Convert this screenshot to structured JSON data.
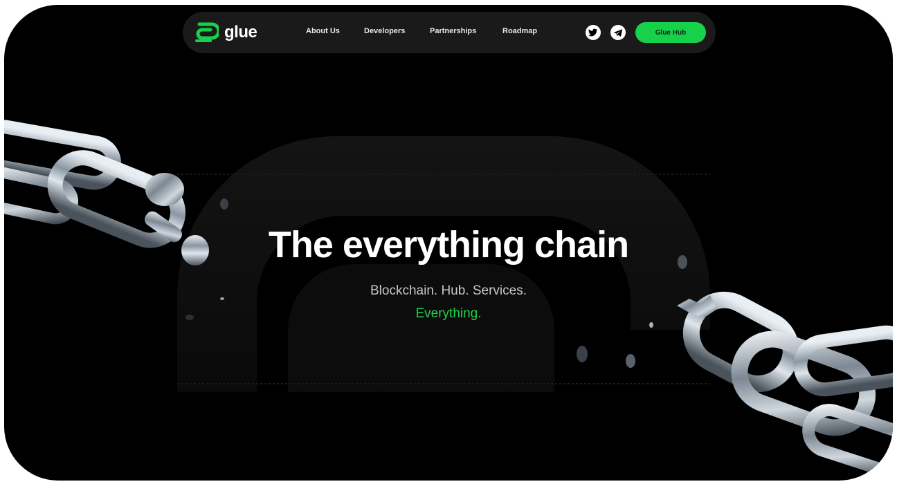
{
  "brand": {
    "name": "glue",
    "accent": "#18d14b",
    "logo_icon": "glue-logo-icon"
  },
  "nav": {
    "links": [
      {
        "label": "About Us"
      },
      {
        "label": "Developers"
      },
      {
        "label": "Partnerships"
      },
      {
        "label": "Roadmap"
      }
    ],
    "social": [
      {
        "icon": "twitter-icon"
      },
      {
        "icon": "telegram-icon"
      }
    ],
    "cta_label": "Glue Hub"
  },
  "hero": {
    "title": "The everything chain",
    "subtitle": "Blockchain. Hub. Services.",
    "accent_text": "Everything."
  },
  "colors": {
    "background": "#000000",
    "nav_background": "#1a1a1a",
    "text": "#ffffff",
    "muted_text": "#c7c7c7"
  }
}
